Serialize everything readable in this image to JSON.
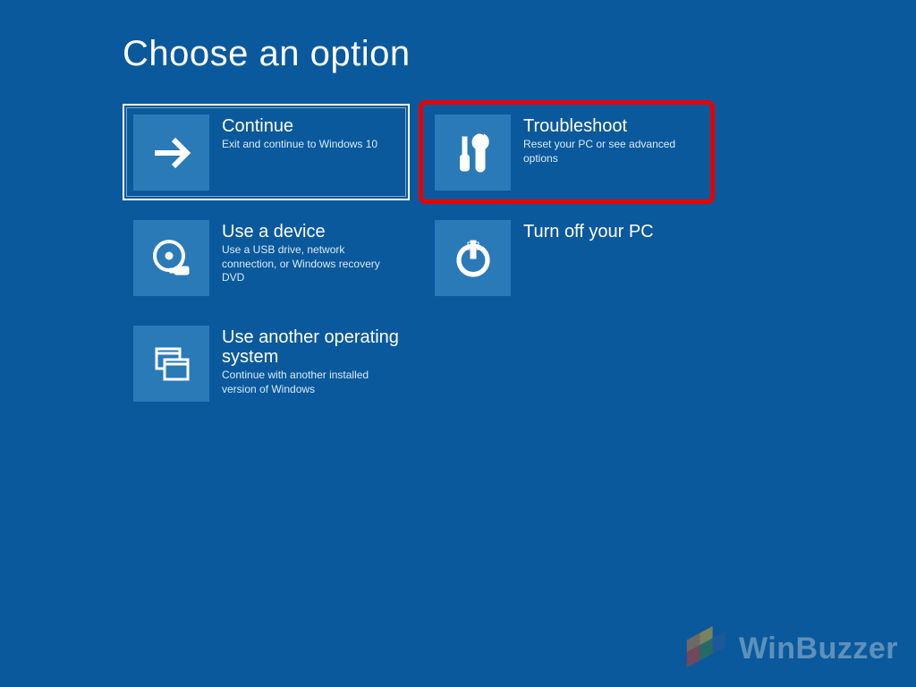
{
  "title": "Choose an option",
  "options": {
    "continue": {
      "title": "Continue",
      "subtitle": "Exit and continue to Windows 10"
    },
    "troubleshoot": {
      "title": "Troubleshoot",
      "subtitle": "Reset your PC or see advanced options"
    },
    "use_device": {
      "title": "Use a device",
      "subtitle": "Use a USB drive, network connection, or Windows recovery DVD"
    },
    "turn_off": {
      "title": "Turn off your PC",
      "subtitle": ""
    },
    "use_another_os": {
      "title": "Use another operating system",
      "subtitle": "Continue with another installed version of Windows"
    }
  },
  "watermark": "WinBuzzer",
  "colors": {
    "background": "#0b599d",
    "tile": "#2a7ab8",
    "highlight": "#e80000"
  }
}
